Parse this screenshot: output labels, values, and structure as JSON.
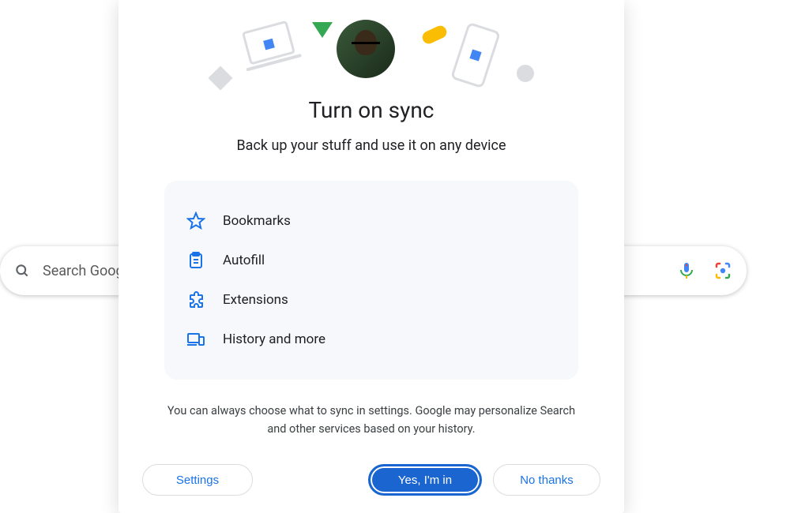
{
  "search": {
    "placeholder": "Search Google or type a URL",
    "mic_name": "mic-icon",
    "lens_name": "lens-icon"
  },
  "modal": {
    "title": "Turn on sync",
    "subtitle": "Back up your stuff and use it on any device",
    "features": [
      {
        "icon": "star-icon",
        "label": "Bookmarks"
      },
      {
        "icon": "clipboard-icon",
        "label": "Autofill"
      },
      {
        "icon": "extension-icon",
        "label": "Extensions"
      },
      {
        "icon": "devices-icon",
        "label": "History and more"
      }
    ],
    "fine_print": "You can always choose what to sync in settings. Google may personalize Search and other services based on your history.",
    "buttons": {
      "settings": "Settings",
      "yes": "Yes, I'm in",
      "no": "No thanks"
    }
  }
}
